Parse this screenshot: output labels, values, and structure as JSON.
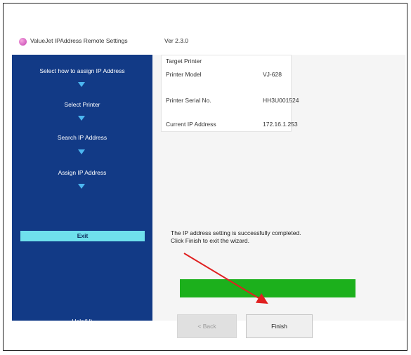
{
  "window": {
    "title": "ValueJet IPAddress Remote Settings",
    "version": "Ver 2.3.0",
    "app_icon": "app-icon"
  },
  "sidebar": {
    "steps": [
      {
        "label": "Select how to assign IP Address"
      },
      {
        "label": "Select Printer"
      },
      {
        "label": "Search IP Address"
      },
      {
        "label": "Assign IP Address"
      },
      {
        "label": "Exit"
      }
    ],
    "active_step": "Exit",
    "help_label": "Help(H)",
    "background_color": "#123a86",
    "arrow_color": "#4cb6f0",
    "active_color": "#6fe0ec"
  },
  "target_printer": {
    "group_title": "Target Printer",
    "rows": [
      {
        "label": "Printer Model",
        "value": "VJ-628"
      },
      {
        "label": "Printer Serial No.",
        "value": "HH3U001524"
      },
      {
        "label": "Current IP Address",
        "value": "172.16.1.253"
      }
    ]
  },
  "message": {
    "line1": "The IP address setting is successfully completed.",
    "line2": "Click Finish to exit the wizard."
  },
  "progress": {
    "percent": 100,
    "color": "#1cb01c"
  },
  "buttons": {
    "back_label": "< Back",
    "finish_label": "Finish"
  },
  "annotation": {
    "type": "red-arrow",
    "target": "finish-button",
    "color": "#e02020"
  }
}
